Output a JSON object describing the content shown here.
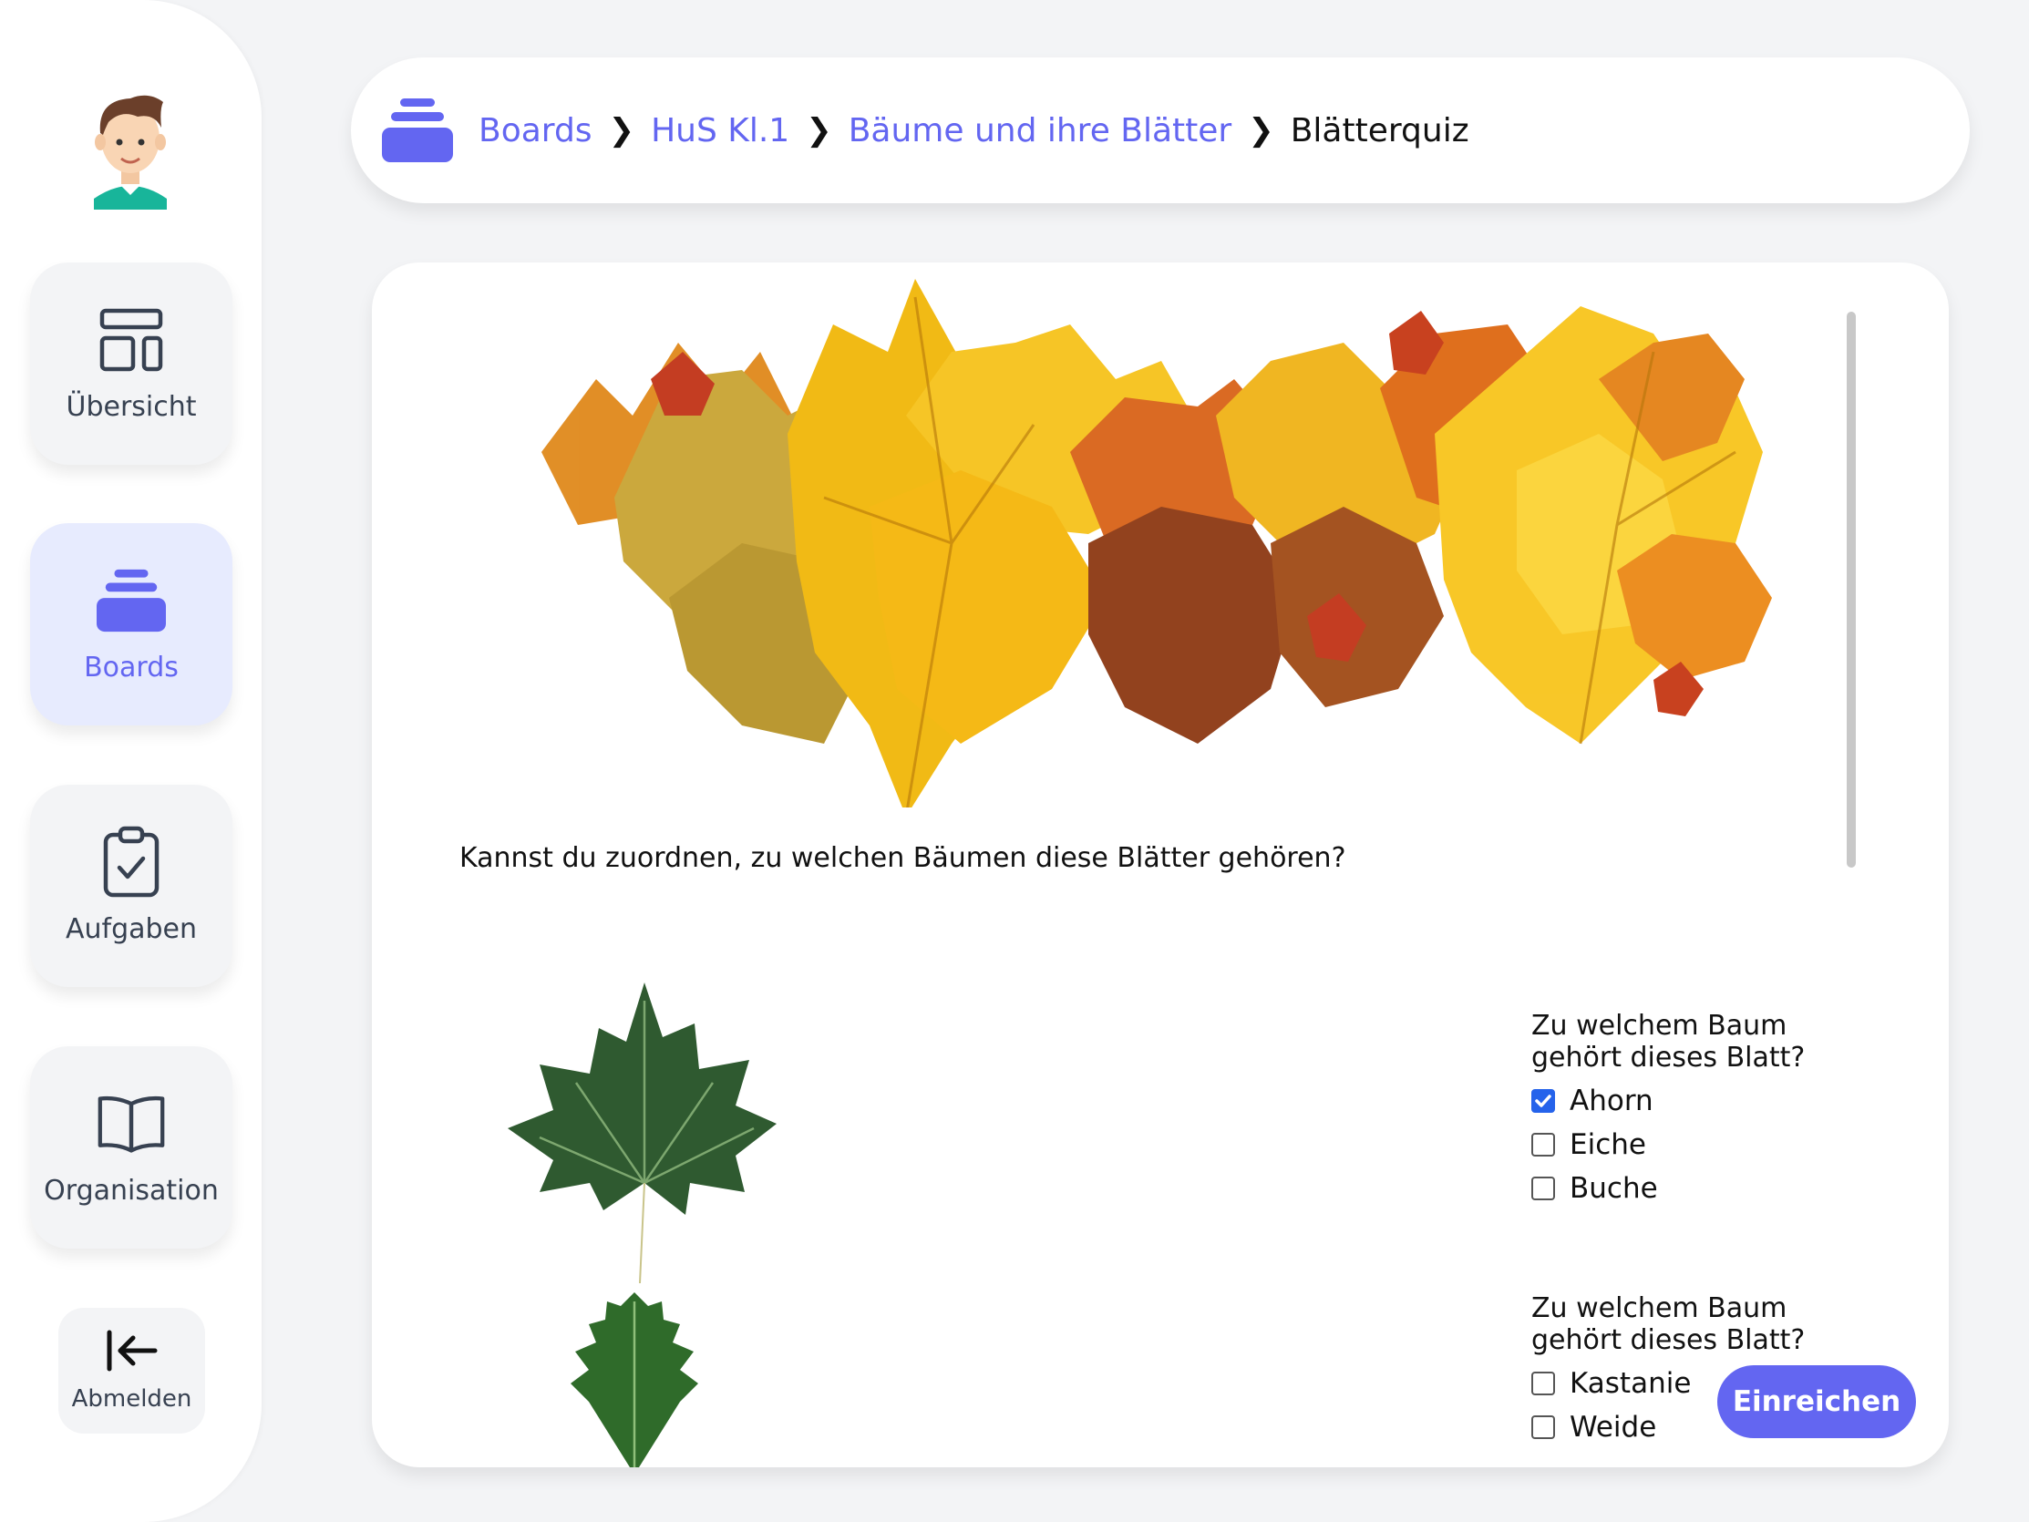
{
  "sidebar": {
    "avatar_icon": "boy-avatar-icon",
    "items": [
      {
        "label": "Übersicht",
        "icon": "layout-icon",
        "active": false
      },
      {
        "label": "Boards",
        "icon": "stack-icon",
        "active": true
      },
      {
        "label": "Aufgaben",
        "icon": "clipboard-check-icon",
        "active": false
      },
      {
        "label": "Organisation",
        "icon": "book-icon",
        "active": false
      }
    ],
    "logout_label": "Abmelden"
  },
  "breadcrumb": {
    "items": [
      "Boards",
      "HuS Kl.1",
      "Bäume und ihre Blätter",
      "Blätterquiz"
    ]
  },
  "quiz": {
    "intro": "Kannst du zuordnen, zu welchen Bäumen diese Blätter gehören?",
    "questions": [
      {
        "text": "Zu welchem Baum gehört dieses Blatt?",
        "image": "maple-leaf-image",
        "options": [
          {
            "label": "Ahorn",
            "checked": true
          },
          {
            "label": "Eiche",
            "checked": false
          },
          {
            "label": "Buche",
            "checked": false
          }
        ]
      },
      {
        "text": "Zu welchem Baum gehört dieses Blatt?",
        "image": "oak-leaf-image",
        "options": [
          {
            "label": "Kastanie",
            "checked": false
          },
          {
            "label": "Weide",
            "checked": false
          }
        ]
      }
    ],
    "submit_label": "Einreichen"
  },
  "colors": {
    "accent": "#6366f1",
    "active_nav_bg": "#e7ebfe",
    "checkbox_checked": "#2563eb",
    "page_bg": "#f3f4f6"
  }
}
